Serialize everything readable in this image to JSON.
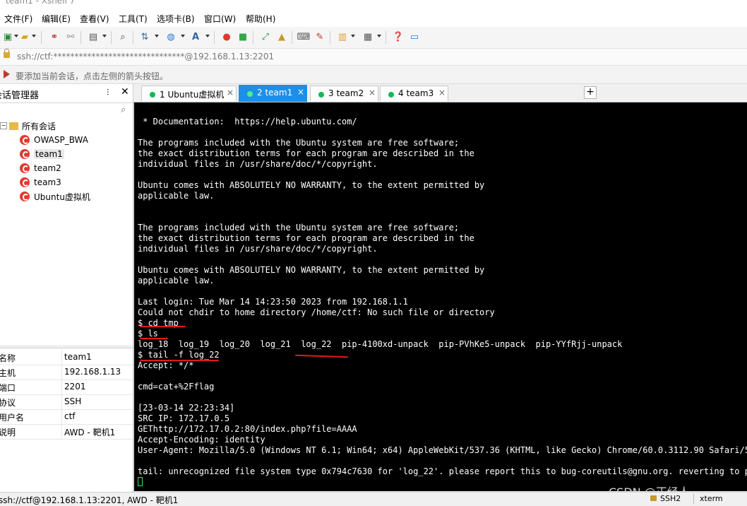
{
  "window": {
    "title": "team1 - Xshell 7"
  },
  "menu": [
    "文件(F)",
    "编辑(E)",
    "查看(V)",
    "工具(T)",
    "选项卡(B)",
    "窗口(W)",
    "帮助(H)"
  ],
  "address": {
    "text": "ssh://ctf:*******************************@192.168.1.13:2201"
  },
  "hint": {
    "text": "要添加当前会话，点击左侧的箭头按钮。"
  },
  "session_manager": {
    "title": "会话管理器",
    "root": "所有会话",
    "items": [
      "OWASP_BWA",
      "team1",
      "team2",
      "team3",
      "Ubuntu虚拟机"
    ],
    "selected": "team1",
    "properties": [
      {
        "key": "名称",
        "value": "team1"
      },
      {
        "key": "主机",
        "value": "192.168.1.13"
      },
      {
        "key": "端口",
        "value": "2201"
      },
      {
        "key": "协议",
        "value": "SSH"
      },
      {
        "key": "用户名",
        "value": "ctf"
      },
      {
        "key": "说明",
        "value": "AWD - 靶机1"
      }
    ]
  },
  "tabs": [
    {
      "label": "1 Ubuntu虚拟机",
      "active": false
    },
    {
      "label": "2 team1",
      "active": true
    },
    {
      "label": "3 team2",
      "active": false
    },
    {
      "label": "4 team3",
      "active": false
    }
  ],
  "tab_add": "+",
  "tab_close": "×",
  "terminal": {
    "lines": [
      " * Documentation:  https://help.ubuntu.com/",
      "",
      "The programs included with the Ubuntu system are free software;",
      "the exact distribution terms for each program are described in the",
      "individual files in /usr/share/doc/*/copyright.",
      "",
      "Ubuntu comes with ABSOLUTELY NO WARRANTY, to the extent permitted by",
      "applicable law.",
      "",
      "",
      "The programs included with the Ubuntu system are free software;",
      "the exact distribution terms for each program are described in the",
      "individual files in /usr/share/doc/*/copyright.",
      "",
      "Ubuntu comes with ABSOLUTELY NO WARRANTY, to the extent permitted by",
      "applicable law.",
      "",
      "Last login: Tue Mar 14 14:23:50 2023 from 192.168.1.1",
      "Could not chdir to home directory /home/ctf: No such file or directory",
      "$ cd tmp",
      "$ ls",
      "log_18  log_19  log_20  log_21  log_22  pip-4100xd-unpack  pip-PVhKe5-unpack  pip-YYfRjj-unpack",
      "$ tail -f log_22",
      "Accept: */*",
      "",
      "cmd=cat+%2Fflag",
      "",
      "[23-03-14 22:23:34]",
      "SRC IP: 172.17.0.5",
      "GEThttp://172.17.0.2:80/index.php?file=AAAA",
      "Accept-Encoding: identity",
      "User-Agent: Mozilla/5.0 (Windows NT 6.1; Win64; x64) AppleWebKit/537.36 (KHTML, like Gecko) Chrome/60.0.3112.90 Safari/537.36",
      "",
      "tail: unrecognized file system type 0x794c7630 for 'log_22'. please report this to bug-coreutils@gnu.org. reverting to polling"
    ]
  },
  "watermark": "CSDN @正经人_",
  "statusbar": {
    "text": "ssh://ctf@192.168.1.13:2201, AWD - 靶机1",
    "protocol": "SSH2",
    "term": "xterm"
  },
  "toolbar_icons": [
    "new-session-icon",
    "open-folder-icon",
    "connect-icon",
    "disconnect-icon",
    "session-properties-icon",
    "find-icon",
    "transfer-icon",
    "globe-icon",
    "font-icon",
    "xshell-icon",
    "xftp-icon",
    "fullscreen-icon",
    "lock-icon",
    "keyboard-icon",
    "highlight-icon",
    "new-tab-icon",
    "layout-icon",
    "help-icon",
    "chat-icon"
  ]
}
